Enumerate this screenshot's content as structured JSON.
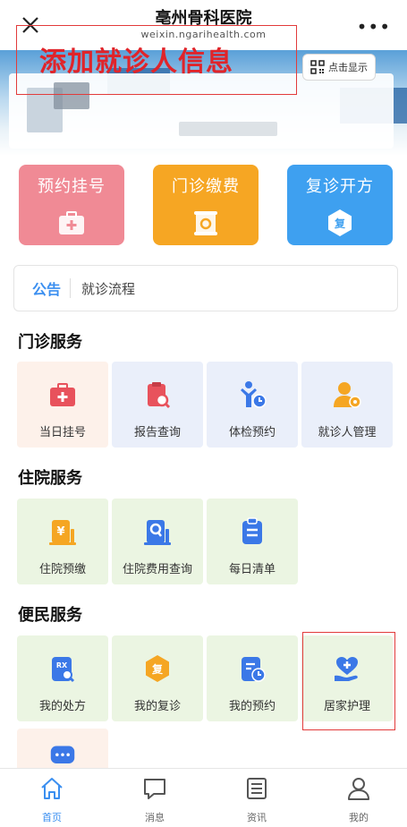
{
  "header": {
    "title": "亳州骨科医院",
    "domain": "weixin.ngarihealth.com"
  },
  "banner": {
    "add_patient": "添加就诊人信息",
    "qr_label": "点击显示"
  },
  "quick_actions": [
    {
      "label": "预约挂号",
      "color": "#f08a95",
      "icon": "medical-kit-icon"
    },
    {
      "label": "门诊缴费",
      "color": "#f6a623",
      "icon": "payment-scroll-icon"
    },
    {
      "label": "复诊开方",
      "color": "#3ea0f0",
      "icon": "revisit-hexagon-icon"
    }
  ],
  "notice": {
    "tag": "公告",
    "text": "就诊流程"
  },
  "sections": {
    "outpatient": {
      "title": "门诊服务",
      "items": [
        {
          "label": "当日挂号",
          "icon": "medical-kit-icon"
        },
        {
          "label": "报告查询",
          "icon": "report-search-icon"
        },
        {
          "label": "体检预约",
          "icon": "checkup-clock-icon"
        },
        {
          "label": "就诊人管理",
          "icon": "patient-settings-icon"
        }
      ]
    },
    "inpatient": {
      "title": "住院服务",
      "items": [
        {
          "label": "住院预缴",
          "icon": "deposit-icon"
        },
        {
          "label": "住院费用查询",
          "icon": "fee-search-icon"
        },
        {
          "label": "每日清单",
          "icon": "daily-list-icon"
        }
      ]
    },
    "convenience": {
      "title": "便民服务",
      "items": [
        {
          "label": "我的处方",
          "icon": "prescription-icon"
        },
        {
          "label": "我的复诊",
          "icon": "revisit-hexagon-icon"
        },
        {
          "label": "我的预约",
          "icon": "appointment-icon"
        },
        {
          "label": "居家护理",
          "icon": "home-care-icon"
        },
        {
          "label": "",
          "icon": "chat-bubble-icon"
        }
      ]
    }
  },
  "tabs": [
    {
      "label": "首页",
      "icon": "home-icon"
    },
    {
      "label": "消息",
      "icon": "message-icon"
    },
    {
      "label": "资讯",
      "icon": "news-icon"
    },
    {
      "label": "我的",
      "icon": "profile-icon"
    }
  ],
  "colors": {
    "accent": "#3b8ff0",
    "highlight_border": "#e23b3b",
    "add_patient_text": "#e0242a"
  }
}
